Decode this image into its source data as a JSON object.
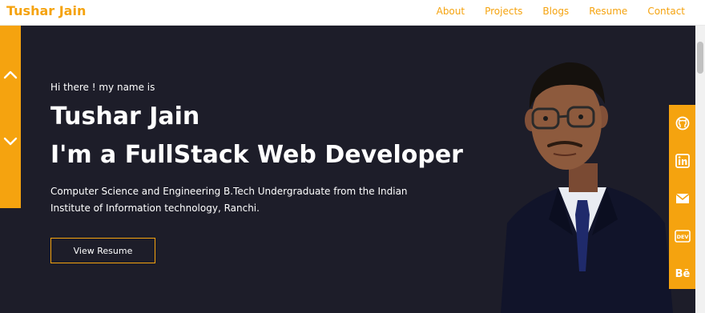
{
  "nav": {
    "brand": "Tushar Jain",
    "links": [
      "About",
      "Projects",
      "Blogs",
      "Resume",
      "Contact"
    ]
  },
  "hero": {
    "greeting": "Hi there ! my name is",
    "name": "Tushar Jain",
    "role": "I'm a FullStack Web Developer",
    "description": "Computer Science and Engineering B.Tech Undergraduate from the Indian Institute of Information technology, Ranchi.",
    "resume_button": "View Resume"
  },
  "social": {
    "icons": [
      "github-icon",
      "linkedin-icon",
      "mail-icon",
      "dev-icon",
      "behance-icon"
    ],
    "dev_label": "DEV",
    "behance_label": "Bē"
  },
  "colors": {
    "accent": "#f5a30f",
    "hero_bg": "#1d1d29",
    "text": "#ffffff"
  }
}
